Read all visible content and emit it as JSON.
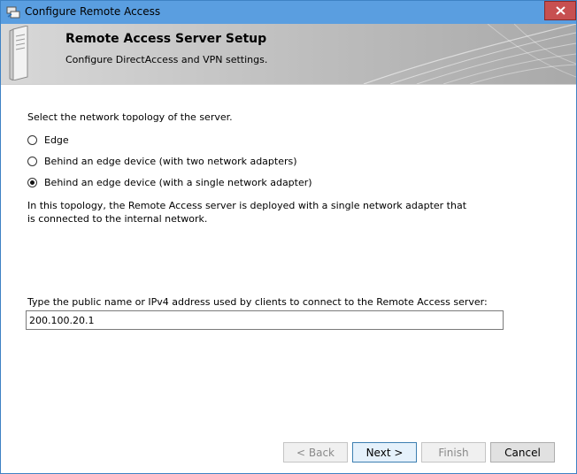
{
  "window": {
    "title": "Configure Remote Access"
  },
  "banner": {
    "title": "Remote Access Server Setup",
    "subtitle": "Configure DirectAccess and VPN settings."
  },
  "topology": {
    "prompt": "Select the network topology of the server.",
    "options": [
      {
        "label": "Edge",
        "selected": false
      },
      {
        "label": "Behind an edge device (with two network adapters)",
        "selected": false
      },
      {
        "label": "Behind an edge device (with a single network adapter)",
        "selected": true
      }
    ],
    "description": "In this topology, the Remote Access server is deployed with a single network adapter that is connected to the internal network."
  },
  "public_name": {
    "label": "Type the public name or IPv4 address used by clients to connect to the Remote Access server:",
    "value": "200.100.20.1"
  },
  "buttons": {
    "back": "< Back",
    "next": "Next >",
    "finish": "Finish",
    "cancel": "Cancel"
  },
  "colors": {
    "titlebar": "#5a9ee0",
    "close": "#c75050"
  }
}
